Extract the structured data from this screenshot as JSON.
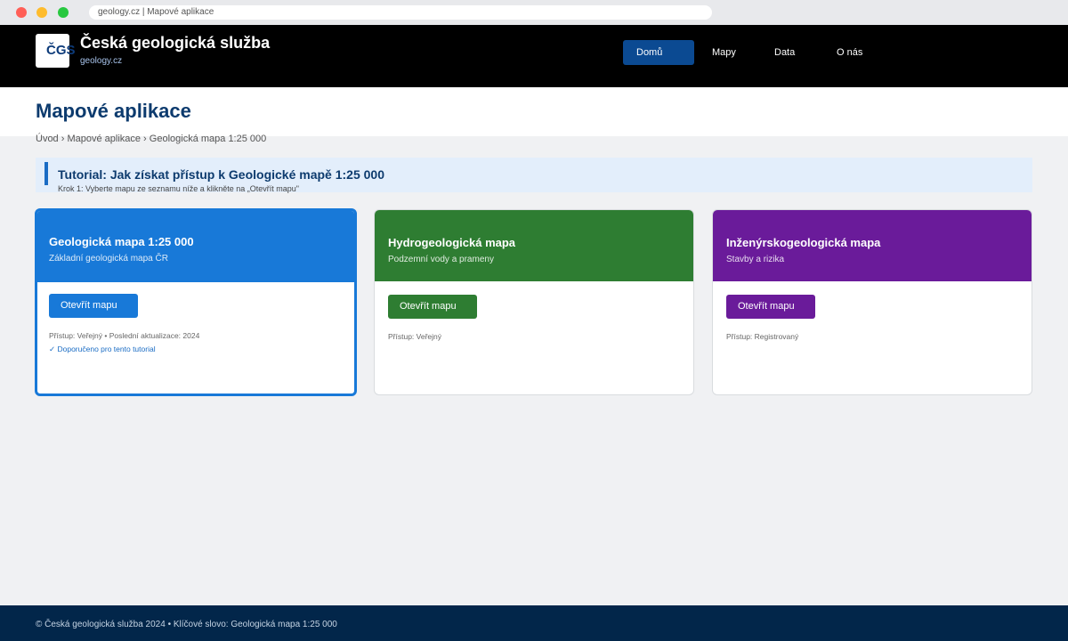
{
  "browser": {
    "url": "geology.cz | Mapové aplikace"
  },
  "header": {
    "logo_text": "ČGS",
    "title": "Česká geologická služba",
    "subtitle": "geology.cz",
    "nav": [
      {
        "label": "Domů",
        "active": true
      },
      {
        "label": "Mapy",
        "active": false
      },
      {
        "label": "Data",
        "active": false
      },
      {
        "label": "O nás",
        "active": false
      }
    ]
  },
  "page": {
    "title": "Mapové aplikace",
    "breadcrumb": "Úvod › Mapové aplikace › Geologická mapa 1:25 000"
  },
  "tutorial": {
    "title": "Tutorial: Jak získat přístup k Geologické mapě 1:25 000",
    "step": "Krok 1: Vyberte mapu ze seznamu níže a klikněte na „Otevřít mapu\""
  },
  "cards": [
    {
      "title": "Geologická mapa 1:25 000",
      "subtitle": "Základní geologická mapa ČR",
      "button": "Otevřít mapu",
      "meta": "Přístup: Veřejný • Poslední aktualizace: 2024",
      "recommendation": "✓ Doporučeno pro tento tutorial",
      "color": "#1879d8",
      "highlighted": true
    },
    {
      "title": "Hydrogeologická mapa",
      "subtitle": "Podzemní vody a prameny",
      "button": "Otevřít mapu",
      "meta": "Přístup: Veřejný",
      "color": "#2e7d32",
      "highlighted": false
    },
    {
      "title": "Inženýrskogeologická mapa",
      "subtitle": "Stavby a rizika",
      "button": "Otevřít mapu",
      "meta": "Přístup: Registrovaný",
      "color": "#6a1b9a",
      "highlighted": false
    }
  ],
  "footer": {
    "text": "© Česká geologická služba 2024 • Klíčové slovo: Geologická mapa 1:25 000"
  }
}
